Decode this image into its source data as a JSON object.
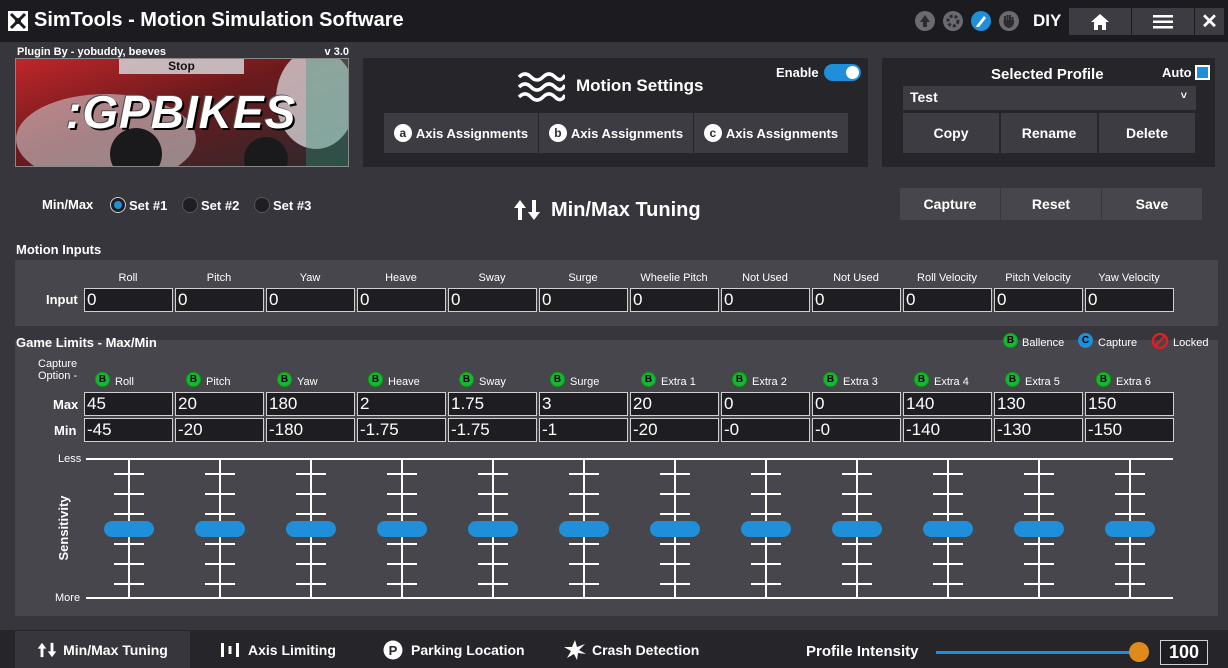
{
  "titlebar": {
    "title": "SimTools - Motion Simulation Software",
    "mode": "DIY",
    "icons": [
      "arrow-up-icon",
      "gear-icon",
      "pencil-icon",
      "hand-icon"
    ]
  },
  "plugin": {
    "author": "Plugin By - yobuddy, beeves",
    "version": "v 3.0",
    "stop_label": "Stop",
    "game_logo": ":GPBIKES"
  },
  "motion_settings": {
    "title": "Motion Settings",
    "enable_label": "Enable",
    "enabled": true,
    "axis_buttons": [
      {
        "letter": "a",
        "label": "Axis Assignments"
      },
      {
        "letter": "b",
        "label": "Axis Assignments"
      },
      {
        "letter": "c",
        "label": "Axis Assignments"
      }
    ]
  },
  "profile": {
    "title": "Selected Profile",
    "auto_label": "Auto",
    "auto_checked": true,
    "selected": "Test",
    "buttons": [
      "Copy",
      "Rename",
      "Delete"
    ]
  },
  "tuning": {
    "minmax_label": "Min/Max",
    "sets": [
      "Set #1",
      "Set #2",
      "Set #3"
    ],
    "selected_set": 0,
    "title": "Min/Max Tuning",
    "actions": [
      "Capture",
      "Reset",
      "Save"
    ]
  },
  "motion_inputs": {
    "title": "Motion Inputs",
    "row_label": "Input",
    "columns": [
      "Roll",
      "Pitch",
      "Yaw",
      "Heave",
      "Sway",
      "Surge",
      "Wheelie Pitch",
      "Not Used",
      "Not Used",
      "Roll Velocity",
      "Pitch Velocity",
      "Yaw Velocity"
    ],
    "values": [
      "0",
      "0",
      "0",
      "0",
      "0",
      "0",
      "0",
      "0",
      "0",
      "0",
      "0",
      "0"
    ]
  },
  "game_limits": {
    "title": "Game Limits - Max/Min",
    "legend": [
      {
        "badge": "B",
        "label": "Ballence",
        "color": "#18b43c"
      },
      {
        "badge": "C",
        "label": "Capture",
        "color": "#1e8fd8"
      },
      {
        "badge": "",
        "label": "Locked",
        "color": "#e02020"
      }
    ],
    "capture_option_label": "Capture Option -",
    "max_label": "Max",
    "min_label": "Min",
    "columns": [
      "Roll",
      "Pitch",
      "Yaw",
      "Heave",
      "Sway",
      "Surge",
      "Extra 1",
      "Extra 2",
      "Extra 3",
      "Extra 4",
      "Extra 5",
      "Extra 6"
    ],
    "badge": "B",
    "max": [
      "45",
      "20",
      "180",
      "2",
      "1.75",
      "3",
      "20",
      "0",
      "0",
      "140",
      "130",
      "150"
    ],
    "min": [
      "-45",
      "-20",
      "-180",
      "-1.75",
      "-1.75",
      "-1",
      "-20",
      "-0",
      "-0",
      "-140",
      "-130",
      "-150"
    ],
    "sensitivity_label": "Sensitivity",
    "less_label": "Less",
    "more_label": "More",
    "slider_level": 0.5
  },
  "bottom": {
    "tabs": [
      "Min/Max Tuning",
      "Axis Limiting",
      "Parking Location",
      "Crash Detection"
    ],
    "intensity_label": "Profile Intensity",
    "intensity_value": "100"
  }
}
